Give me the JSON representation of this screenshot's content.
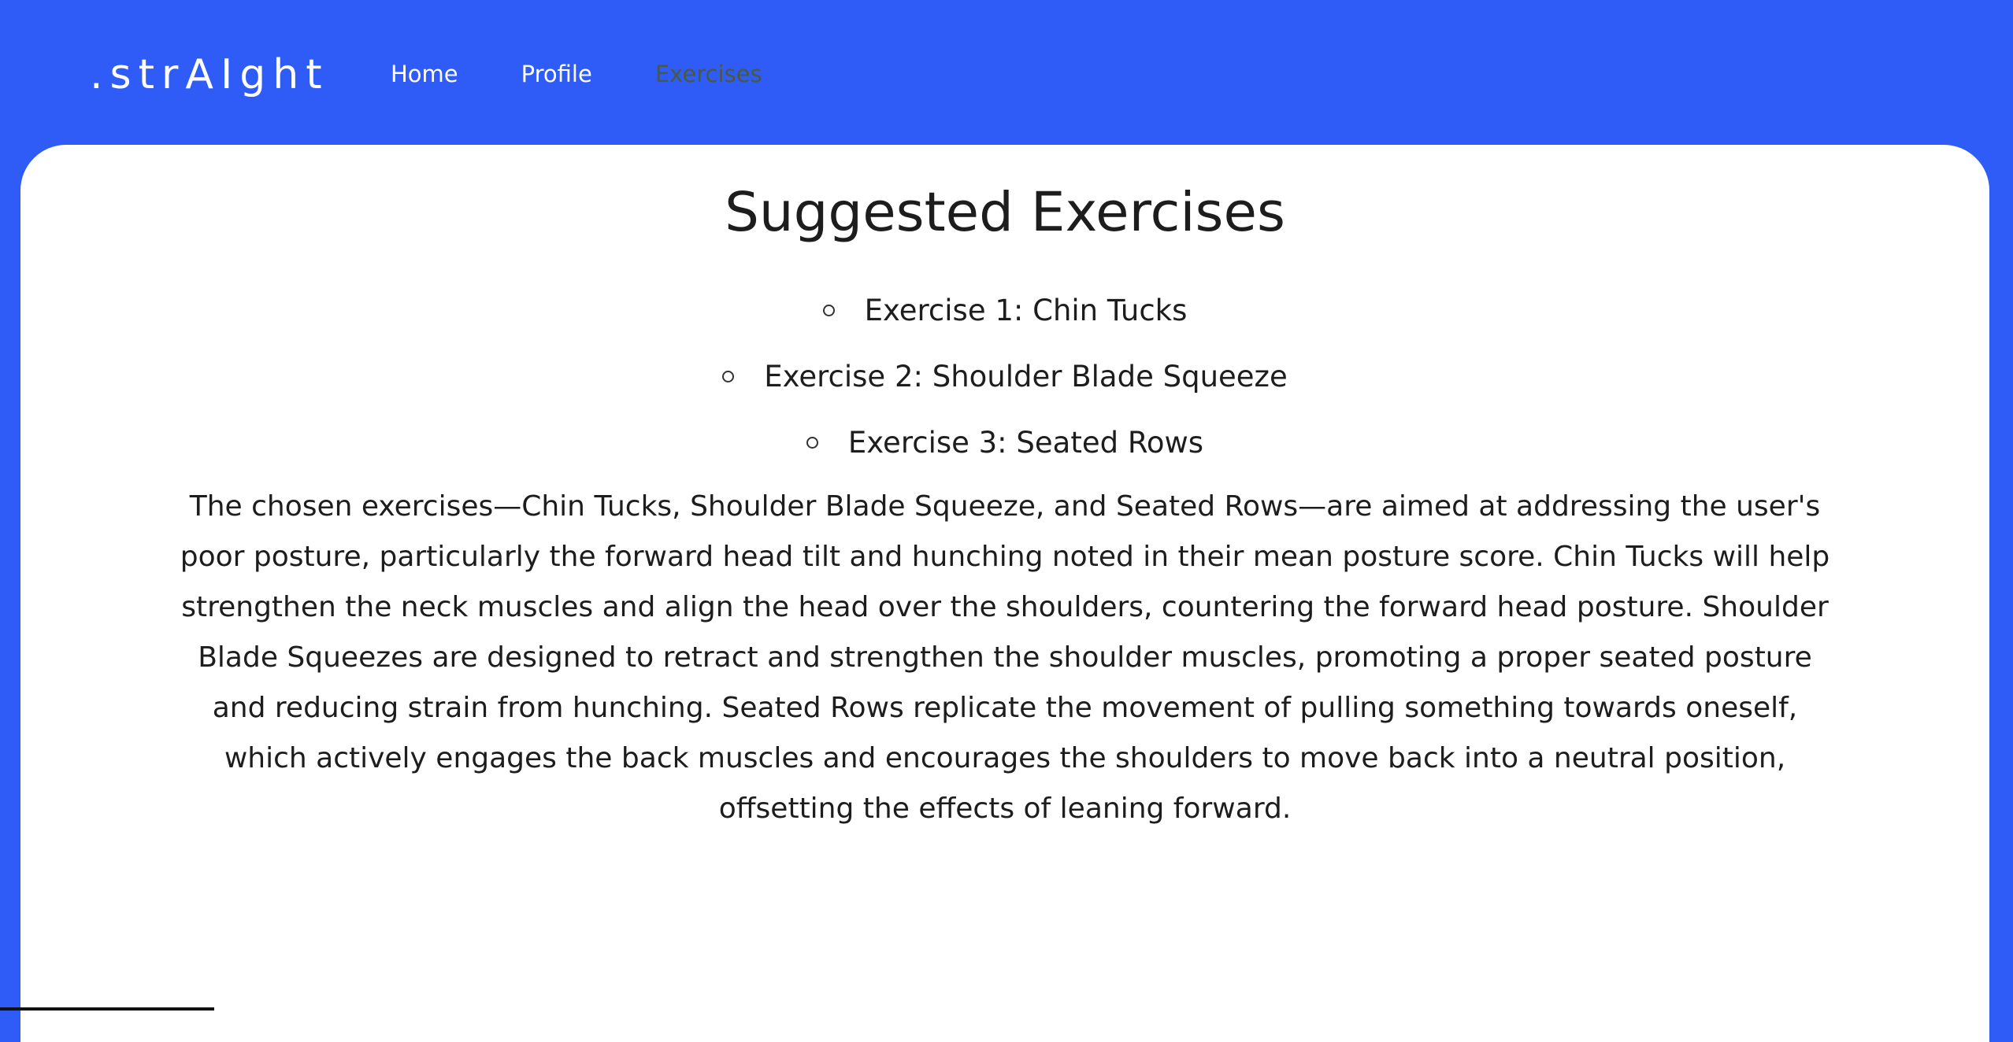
{
  "nav": {
    "brand": ".strAIght",
    "links": [
      {
        "label": "Home"
      },
      {
        "label": "Profile"
      },
      {
        "label": "Exercises"
      }
    ],
    "active_color": "#4a5a3a"
  },
  "main": {
    "title": "Suggested Exercises",
    "exercises": [
      {
        "label": "Exercise 1: Chin Tucks"
      },
      {
        "label": "Exercise 2: Shoulder Blade Squeeze"
      },
      {
        "label": "Exercise 3: Seated Rows"
      }
    ],
    "description": "The chosen exercises—Chin Tucks, Shoulder Blade Squeeze, and Seated Rows—are aimed at addressing the user's poor posture, particularly the forward head tilt and hunching noted in their mean posture score. Chin Tucks will help strengthen the neck muscles and align the head over the shoulders, countering the forward head posture. Shoulder Blade Squeezes are designed to retract and strengthen the shoulder muscles, promoting a proper seated posture and reducing strain from hunching. Seated Rows replicate the movement of pulling something towards oneself, which actively engages the back muscles and encourages the shoulders to move back into a neutral position, offsetting the effects of leaning forward."
  },
  "colors": {
    "background": "#2f5cf7",
    "card": "#ffffff",
    "text": "#1d1d1d"
  }
}
